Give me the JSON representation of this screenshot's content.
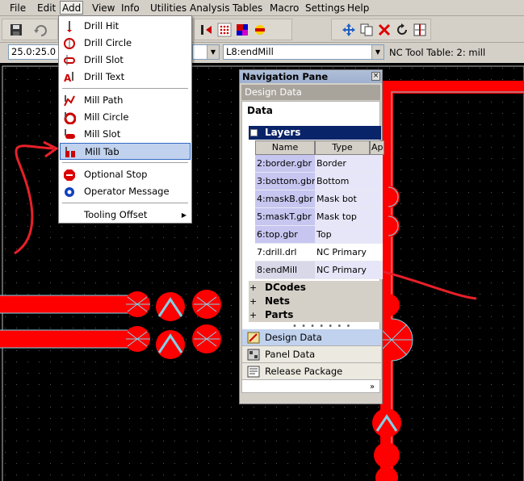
{
  "menubar": {
    "items": [
      "File",
      "Edit",
      "Add",
      "View",
      "Info",
      "Utilities",
      "Analysis",
      "Tables",
      "Macro",
      "Settings",
      "Help"
    ],
    "active": "Add"
  },
  "fields": {
    "coordinate": "25.0:25.0",
    "layer": "L8:endMill",
    "nc_tool_table": "NC Tool Table: 2: mill"
  },
  "add_menu": {
    "items": [
      {
        "label": "Drill Hit",
        "icon": "drill-hit-icon"
      },
      {
        "label": "Drill Circle",
        "icon": "drill-circle-icon"
      },
      {
        "label": "Drill Slot",
        "icon": "drill-slot-icon"
      },
      {
        "label": "Drill Text",
        "icon": "drill-text-icon"
      },
      {
        "label": "Mill Path",
        "icon": "mill-path-icon"
      },
      {
        "label": "Mill Circle",
        "icon": "mill-circle-icon"
      },
      {
        "label": "Mill Slot",
        "icon": "mill-slot-icon"
      },
      {
        "label": "Mill Tab",
        "icon": "mill-tab-icon"
      },
      {
        "label": "Optional Stop",
        "icon": "stop-icon"
      },
      {
        "label": "Operator Message",
        "icon": "message-icon"
      },
      {
        "label": "Tooling Offset",
        "icon": ""
      }
    ],
    "highlighted": "Mill Tab"
  },
  "nav_pane": {
    "title": "Navigation Pane",
    "close": "×",
    "subtitle": "Design Data",
    "data_heading": "Data",
    "layers_section": "Layers",
    "columns": [
      "Name",
      "Type",
      "App"
    ],
    "layers": [
      {
        "name": "2:border.gbr",
        "type": "Border"
      },
      {
        "name": "3:bottom.gbr",
        "type": "Bottom"
      },
      {
        "name": "4:maskB.gbr",
        "type": "Mask bot"
      },
      {
        "name": "5:maskT.gbr",
        "type": "Mask top"
      },
      {
        "name": "6:top.gbr",
        "type": "Top"
      },
      {
        "name": "7:drill.drl",
        "type": "NC Primary"
      },
      {
        "name": "8:endMill",
        "type": "NC Primary"
      }
    ],
    "collapsed_sections": [
      "DCodes",
      "Nets",
      "Parts"
    ],
    "buttons": [
      {
        "label": "Design Data",
        "icon": "design-data-icon"
      },
      {
        "label": "Panel Data",
        "icon": "panel-data-icon"
      },
      {
        "label": "Release Package",
        "icon": "release-package-icon"
      }
    ],
    "grip": "• • • • • • •",
    "chevron": "»"
  },
  "colors": {
    "trace": "#ff0000",
    "outline": "#7fd3e8",
    "background": "#000000",
    "annotation": "#e8202a"
  }
}
